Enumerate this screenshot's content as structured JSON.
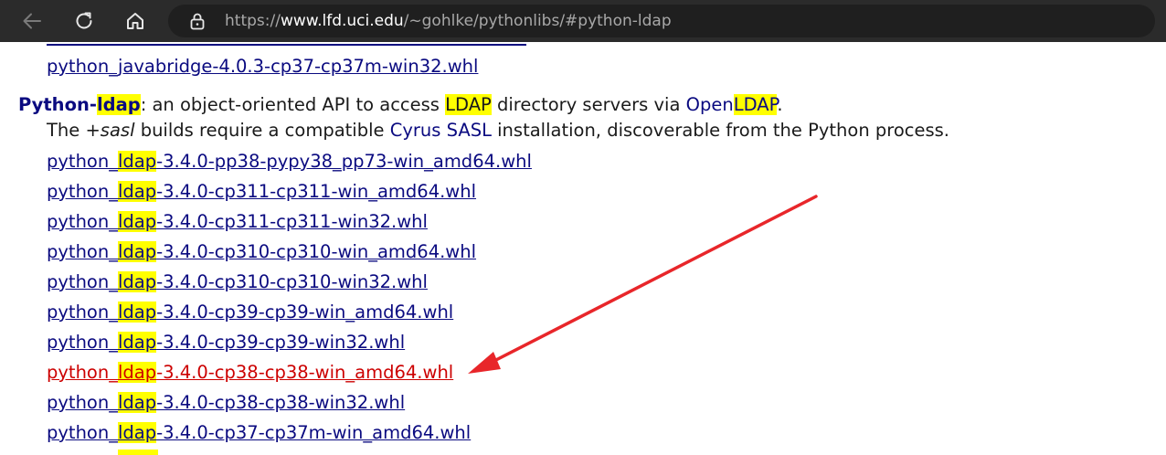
{
  "browser": {
    "url_prefix": "https://",
    "url_host": "www.lfd.uci.edu",
    "url_path": "/~gohlke/pythonlibs/#python-ldap",
    "icons": {
      "back": "arrow-left-icon",
      "reload": "reload-icon",
      "home": "home-icon",
      "lock": "lock-icon"
    }
  },
  "page": {
    "prev_link": "python_javabridge-4.0.3-cp37-cp37m-win32.whl",
    "heading": {
      "name_a": "Python-",
      "name_hl": "ldap",
      "desc_a": ": an object-oriented API to access ",
      "desc_hl": "LDAP",
      "desc_b": " directory servers via ",
      "openldap_a": "Open",
      "openldap_hl": "LDAP",
      "desc_end": "."
    },
    "note": {
      "a": "The ",
      "sasl": "+sasl",
      "b": " builds require a compatible ",
      "cyrus": "Cyrus SASL",
      "c": " installation, discoverable from the Python process."
    },
    "links": [
      {
        "pre": "python_",
        "hl": "ldap",
        "suf": "-3.4.0-pp38-pypy38_pp73-win_amd64.whl"
      },
      {
        "pre": "python_",
        "hl": "ldap",
        "suf": "-3.4.0-cp311-cp311-win_amd64.whl"
      },
      {
        "pre": "python_",
        "hl": "ldap",
        "suf": "-3.4.0-cp311-cp311-win32.whl"
      },
      {
        "pre": "python_",
        "hl": "ldap",
        "suf": "-3.4.0-cp310-cp310-win_amd64.whl"
      },
      {
        "pre": "python_",
        "hl": "ldap",
        "suf": "-3.4.0-cp310-cp310-win32.whl"
      },
      {
        "pre": "python_",
        "hl": "ldap",
        "suf": "-3.4.0-cp39-cp39-win_amd64.whl"
      },
      {
        "pre": "python_",
        "hl": "ldap",
        "suf": "-3.4.0-cp39-cp39-win32.whl"
      },
      {
        "pre": "python_",
        "hl": "ldap",
        "suf": "-3.4.0-cp38-cp38-win_amd64.whl"
      },
      {
        "pre": "python_",
        "hl": "ldap",
        "suf": "-3.4.0-cp38-cp38-win32.whl"
      },
      {
        "pre": "python_",
        "hl": "ldap",
        "suf": "-3.4.0-cp37-cp37m-win_amd64.whl"
      }
    ],
    "colors": {
      "link": "#0a0a80",
      "visited_link": "#cc0000",
      "highlight": "#ffff00",
      "arrow": "#e8262a"
    }
  }
}
